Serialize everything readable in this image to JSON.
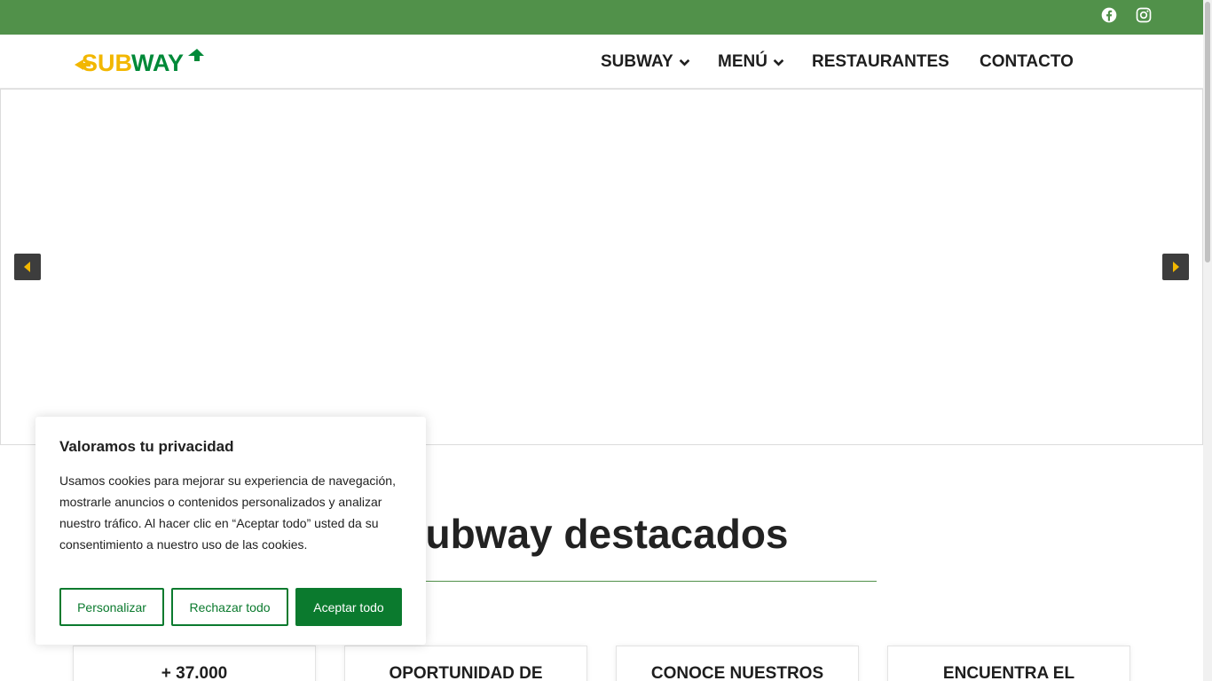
{
  "topbar": {
    "icons": [
      "facebook-icon",
      "instagram-icon"
    ],
    "color": "#51914a"
  },
  "header": {
    "logo_text": "SUBWAY",
    "nav": [
      {
        "label": "SUBWAY",
        "dropdown": true
      },
      {
        "label": "MENÚ",
        "dropdown": true
      },
      {
        "label": "RESTAURANTES",
        "dropdown": false
      },
      {
        "label": "CONTACTO",
        "dropdown": false
      }
    ]
  },
  "slider": {
    "prev_icon": "caret-left-icon",
    "next_icon": "caret-right-icon"
  },
  "section": {
    "title": "ubway destacados"
  },
  "cards": [
    {
      "label": "+ 37.000"
    },
    {
      "label": "OPORTUNIDAD DE"
    },
    {
      "label": "CONOCE NUESTROS"
    },
    {
      "label": "ENCUENTRA EL"
    }
  ],
  "cookie": {
    "title": "Valoramos tu privacidad",
    "text": "Usamos cookies para mejorar su experiencia de navegación, mostrarle anuncios o contenidos personalizados y analizar nuestro tráfico. Al hacer clic en “Aceptar todo” usted da su consentimiento a nuestro uso de las cookies.",
    "buttons": {
      "customize": "Personalizar",
      "reject": "Rechazar todo",
      "accept": "Aceptar todo"
    },
    "accent": "#0b7a2e"
  },
  "colors": {
    "brand_yellow": "#f2b700",
    "brand_green": "#008938"
  }
}
